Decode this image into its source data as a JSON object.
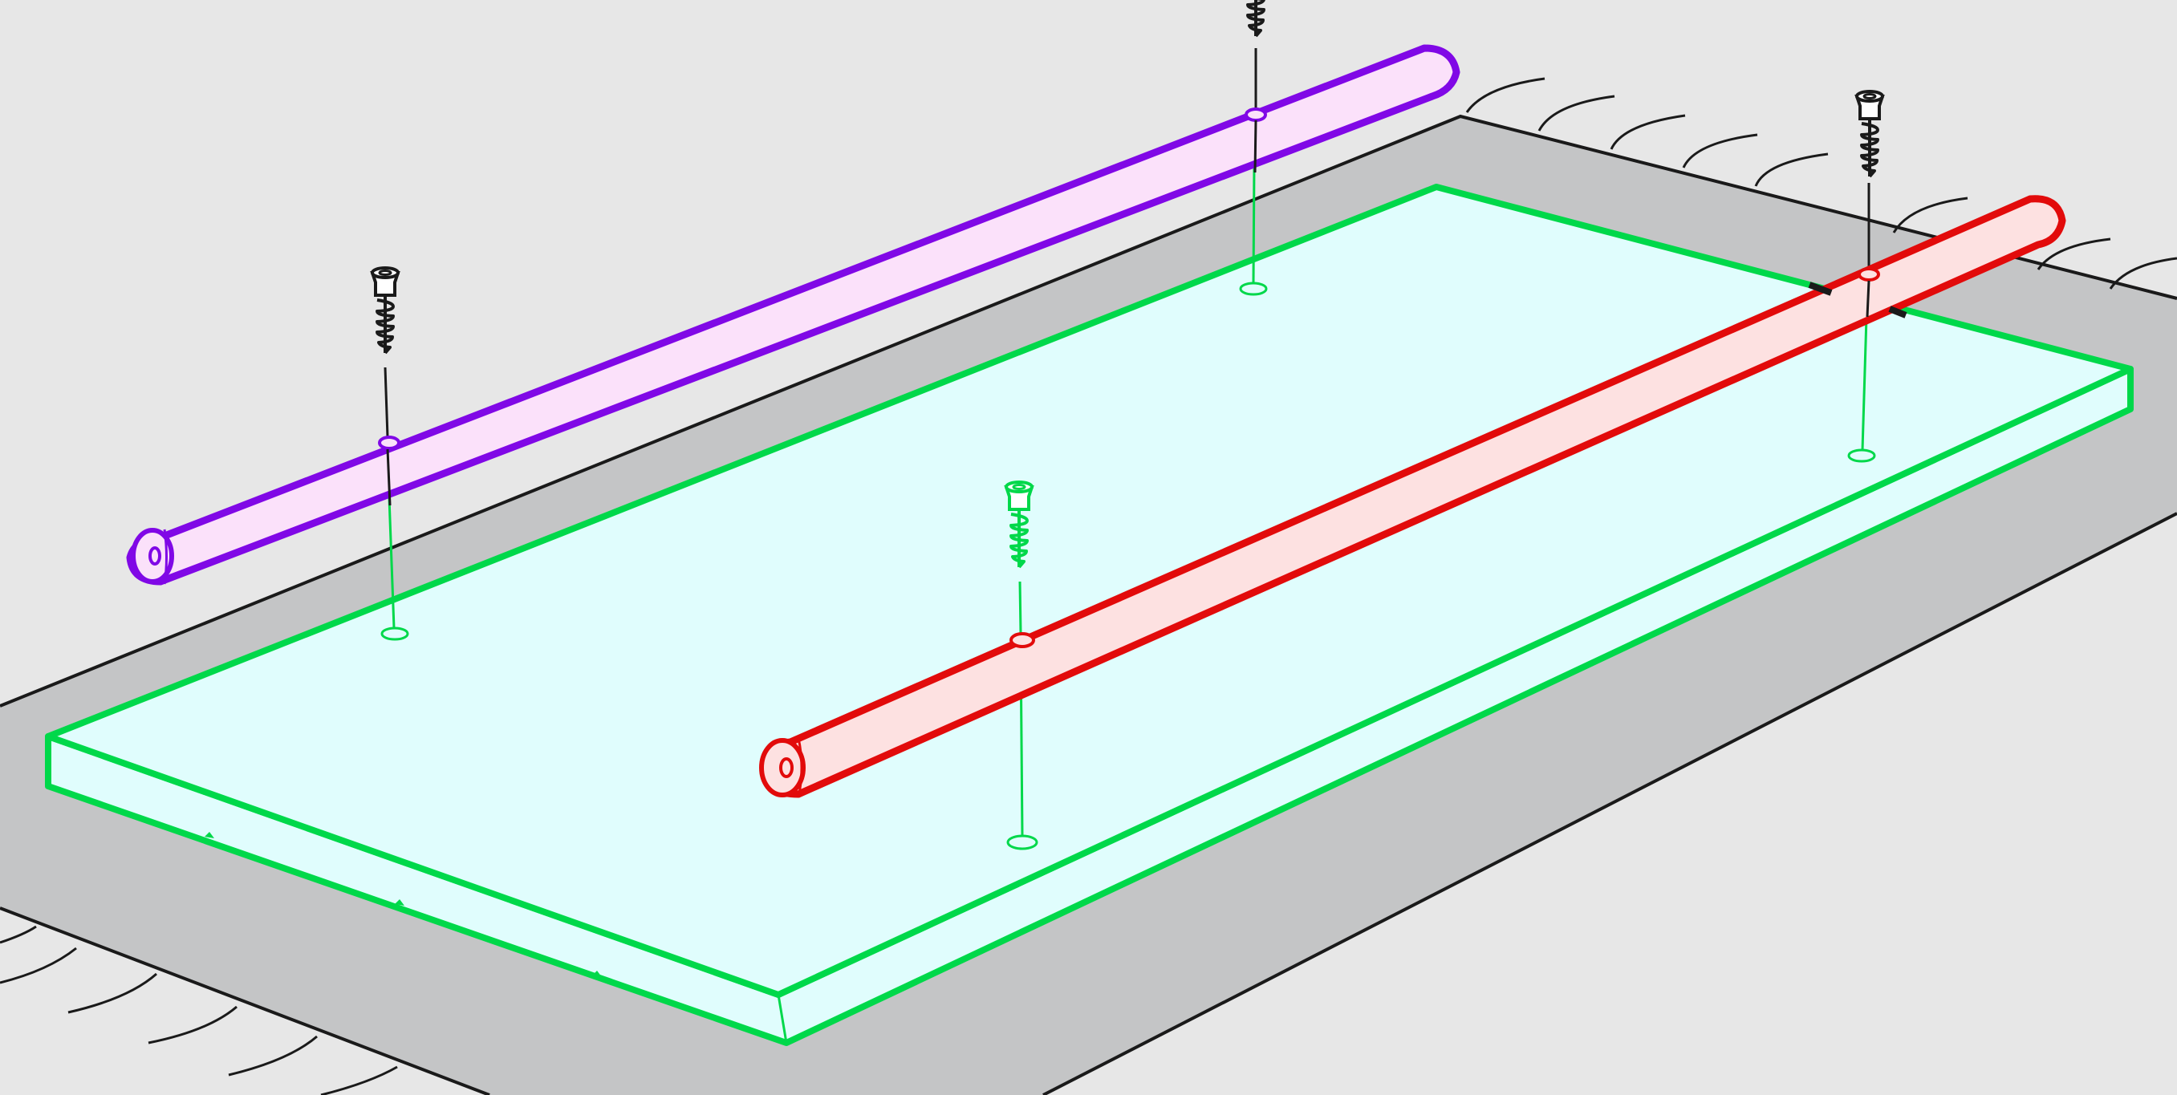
{
  "diagram": {
    "kind": "assembly-instruction",
    "labels": []
  },
  "colors": {
    "background": "#e7e7e7",
    "rug": "#c4c5c6",
    "rug_edge": "#1a1a1a",
    "board_fill": "#e0fdfd",
    "board_stroke": "#00d84a",
    "rail_back_fill": "#fbe1fa",
    "rail_back_stroke": "#8008e6",
    "rail_front_fill": "#fde1e1",
    "rail_front_stroke": "#e20b0b",
    "screw_dark": "#1a1a1a",
    "screw_highlight": "#00d84a"
  },
  "parts": [
    {
      "name": "rug",
      "role": "surface"
    },
    {
      "name": "shelf-board",
      "role": "highlighted-part"
    },
    {
      "name": "rail-back",
      "role": "highlighted-part"
    },
    {
      "name": "rail-front",
      "role": "highlighted-part"
    },
    {
      "name": "screw-left",
      "role": "fastener"
    },
    {
      "name": "screw-top",
      "role": "fastener"
    },
    {
      "name": "screw-right",
      "role": "fastener"
    },
    {
      "name": "screw-center",
      "role": "fastener-highlighted"
    }
  ]
}
